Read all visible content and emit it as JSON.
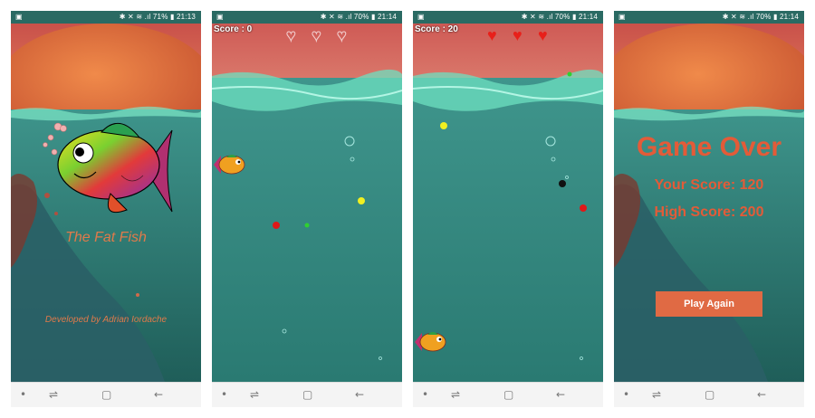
{
  "status": {
    "s1": {
      "left": "▣",
      "right": "✱ ✕ ≋ .ıl 71% ▮ 21:13"
    },
    "s2": {
      "left": "▣",
      "right": "✱ ✕ ≋ .ıl 70% ▮ 21:14"
    },
    "s3": {
      "left": "▣",
      "right": "✱ ✕ ≋ .ıl 70% ▮ 21:14"
    },
    "s4": {
      "left": "▣",
      "right": "✱ ✕ ≋ .ıl 70% ▮ 21:14"
    }
  },
  "nav": {
    "dot": "•",
    "recent": "⇌",
    "home": "▢",
    "back": "←"
  },
  "splash": {
    "title": "The Fat Fish",
    "credit": "Developed by Adrian Iordache"
  },
  "game1": {
    "score": "Score : 0",
    "lives_full": 0,
    "lives_total": 3
  },
  "game2": {
    "score": "Score : 20",
    "lives_full": 3,
    "lives_total": 3
  },
  "gameover": {
    "title": "Game Over",
    "your_score": "Your Score: 120",
    "high_score": "High Score: 200",
    "button": "Play Again"
  },
  "icons": {
    "life_full": "heart-icon",
    "life_empty": "heart-outline-icon",
    "fish": "fish-icon"
  },
  "colors": {
    "accent": "#e35b38",
    "button": "#e06a44",
    "water": "#2f7a74",
    "sky": "#d8615a"
  }
}
